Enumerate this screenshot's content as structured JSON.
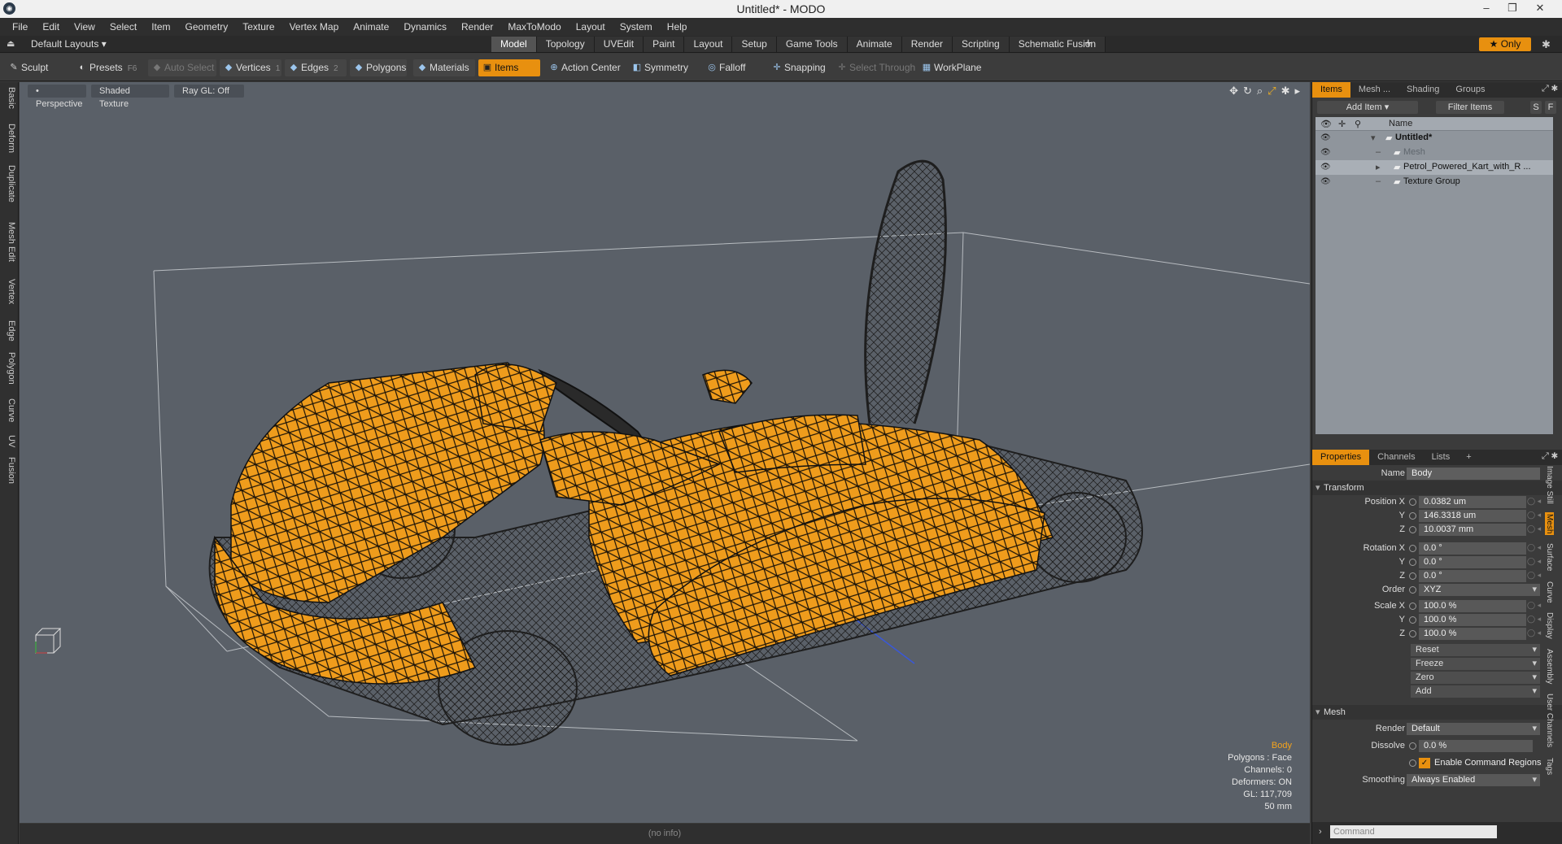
{
  "window": {
    "title": "Untitled* - MODO",
    "app_icon": "modo-logo"
  },
  "menu": [
    "File",
    "Edit",
    "View",
    "Select",
    "Item",
    "Geometry",
    "Texture",
    "Vertex Map",
    "Animate",
    "Dynamics",
    "Render",
    "MaxToModo",
    "Layout",
    "System",
    "Help"
  ],
  "layoutbar": {
    "layout_label": "Default Layouts",
    "tabs": [
      "Model",
      "Topology",
      "UVEdit",
      "Paint",
      "Layout",
      "Setup",
      "Game Tools",
      "Animate",
      "Render",
      "Scripting",
      "Schematic Fusion"
    ],
    "active_tab": "Model",
    "only_label": "Only"
  },
  "toolbar": {
    "sculpt": "Sculpt",
    "presets": "Presets",
    "presets_key": "F6",
    "auto_select": "Auto Select",
    "vertices": "Vertices",
    "vertices_count": "1",
    "edges": "Edges",
    "edges_count": "2",
    "polygons": "Polygons",
    "materials": "Materials",
    "items": "Items",
    "action_center": "Action Center",
    "symmetry": "Symmetry",
    "falloff": "Falloff",
    "snapping": "Snapping",
    "select_through": "Select Through",
    "workplane": "WorkPlane"
  },
  "left_tabs": [
    "Basic",
    "Deform",
    "Duplicate",
    "Mesh Edit",
    "Vertex",
    "Edge",
    "Polygon",
    "Curve",
    "UV",
    "Fusion"
  ],
  "viewport": {
    "perspective": "Perspective",
    "shading": "Shaded Texture",
    "raygl": "Ray GL: Off",
    "info": {
      "selection": "Body",
      "polygons": "Polygons : Face",
      "channels": "Channels: 0",
      "deformers": "Deformers: ON",
      "gl": "GL: 117,709",
      "scale": "50 mm"
    },
    "colors": {
      "wire_selected": "#f0a020",
      "wire_unselected": "#1c1c1c",
      "background": "#5a6068"
    }
  },
  "status": "(no info)",
  "items_panel": {
    "tabs": [
      "Items",
      "Mesh ...",
      "Shading",
      "Groups"
    ],
    "active_tab": "Items",
    "add_item": "Add Item",
    "filter_items": "Filter Items",
    "s_button": "S",
    "f_button": "F",
    "name_header": "Name",
    "rows": [
      {
        "label": "Untitled*",
        "indent": 0,
        "bold": true,
        "dim": false,
        "selected": false
      },
      {
        "label": "Mesh",
        "indent": 1,
        "bold": false,
        "dim": true,
        "selected": false
      },
      {
        "label": "Petrol_Powered_Kart_with_R ...",
        "indent": 1,
        "bold": false,
        "dim": false,
        "selected": true
      },
      {
        "label": "Texture Group",
        "indent": 1,
        "bold": false,
        "dim": false,
        "selected": false
      }
    ]
  },
  "properties_panel": {
    "tabs": [
      "Properties",
      "Channels",
      "Lists"
    ],
    "active_tab": "Properties",
    "name_label": "Name",
    "name_value": "Body",
    "transform_section": "Transform",
    "position_label": "Position X",
    "y_label": "Y",
    "z_label": "Z",
    "position": [
      "0.0382 um",
      "146.3318 um",
      "10.0037 mm"
    ],
    "rotation_label": "Rotation X",
    "rotation": [
      "0.0 °",
      "0.0 °",
      "0.0 °"
    ],
    "order_label": "Order",
    "order": "XYZ",
    "scale_label": "Scale X",
    "scale": [
      "100.0 %",
      "100.0 %",
      "100.0 %"
    ],
    "buttons": [
      "Reset",
      "Freeze",
      "Zero",
      "Add"
    ],
    "mesh_section": "Mesh",
    "render_label": "Render",
    "render": "Default",
    "dissolve_label": "Dissolve",
    "dissolve": "0.0 %",
    "enable_command_regions": "Enable Command Regions",
    "smoothing_label": "Smoothing",
    "smoothing": "Always Enabled",
    "side_tabs": [
      "Image Still",
      "Mesh",
      "Surface",
      "Curve",
      "Display",
      "Assembly",
      "User Channels",
      "Tags"
    ],
    "active_side_tab": "Mesh"
  },
  "command": {
    "placeholder": "Command"
  }
}
